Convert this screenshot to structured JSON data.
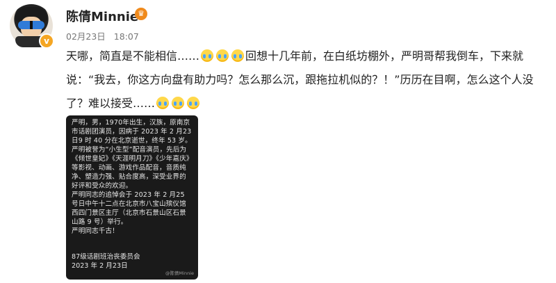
{
  "post": {
    "author": "陈倩Minnie",
    "date": "02月23日",
    "time": "18:07",
    "text_part1": "天哪，简直是不能相信……",
    "text_part2": "回想十几年前，在白纸坊棚外，严明哥帮我倒车，下来就说：“我去，你这方向盘有助力吗？怎么那么沉，跟拖拉机似的？！”历历在目啊，怎么这个人没了？难以接受……",
    "emoji_name": "crying-emoji"
  },
  "notice": {
    "body": "严明，男，1970年出生，汉族，原南京市话剧团演员，因病于 2023 年 2 月23 日9 时 40 分在北京逝世，终年 53 岁。\n严明被誉为“小生型”配音演员，先后为《倾世皇妃》《天涯明月刀》《少年嘉庆》等影视、动画、游戏作品配音，音质纯净、塑造力强、贴合度高，深受业界的好评和受众的欢迎。\n严明同志的追悼会于 2023 年 2 月25 号日中午十二点在北京市八宝山殡仪馆西四门景区主厅（北京市石景山区石景山路 9 号）举行。\n严明同志千古！",
    "signature": "87级话剧班治丧委员会\n2023 年 2 月23日",
    "watermark": "@陈倩Minnie"
  }
}
